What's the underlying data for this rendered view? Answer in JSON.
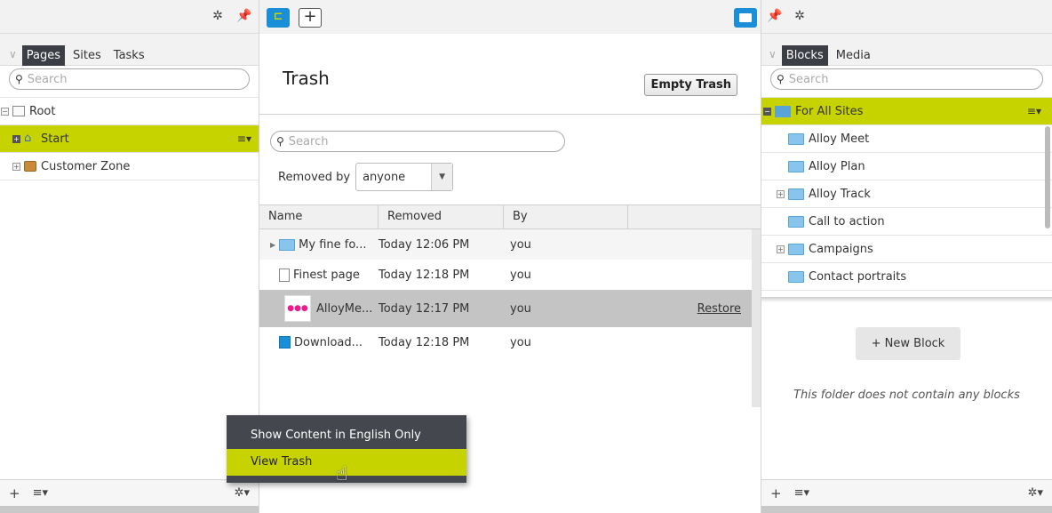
{
  "left_pane": {
    "tabs": [
      "Pages",
      "Sites",
      "Tasks"
    ],
    "search_placeholder": "Search",
    "tree": [
      {
        "label": "Root"
      },
      {
        "label": "Start"
      },
      {
        "label": "Customer Zone"
      }
    ]
  },
  "center_pane": {
    "title": "Trash",
    "empty_trash_label": "Empty Trash",
    "search_placeholder": "Search",
    "removed_by_label": "Removed by",
    "removed_by_value": "anyone",
    "columns": [
      "Name",
      "Removed",
      "By"
    ],
    "rows": [
      {
        "name": "My fine fo...",
        "removed": "Today 12:06 PM",
        "by": "you"
      },
      {
        "name": "Finest page",
        "removed": "Today 12:18 PM",
        "by": "you"
      },
      {
        "name": "AlloyMe...",
        "removed": "Today 12:17 PM",
        "by": "you",
        "action": "Restore"
      },
      {
        "name": "Download...",
        "removed": "Today 12:18 PM",
        "by": "you"
      }
    ]
  },
  "context_menu": {
    "items": [
      "Show Content in English Only",
      "View Trash"
    ]
  },
  "right_pane": {
    "tabs": [
      "Blocks",
      "Media"
    ],
    "search_placeholder": "Search",
    "tree": [
      {
        "label": "For All Sites"
      },
      {
        "label": "Alloy Meet"
      },
      {
        "label": "Alloy Plan"
      },
      {
        "label": "Alloy Track"
      },
      {
        "label": "Call to action"
      },
      {
        "label": "Campaigns"
      },
      {
        "label": "Contact portraits"
      }
    ],
    "new_block_label": "+ New Block",
    "empty_message": "This folder does not contain any blocks"
  },
  "colors": {
    "selection": "#c7d300",
    "accent_blue": "#1a8fd8",
    "menu_bg": "#44474d"
  }
}
